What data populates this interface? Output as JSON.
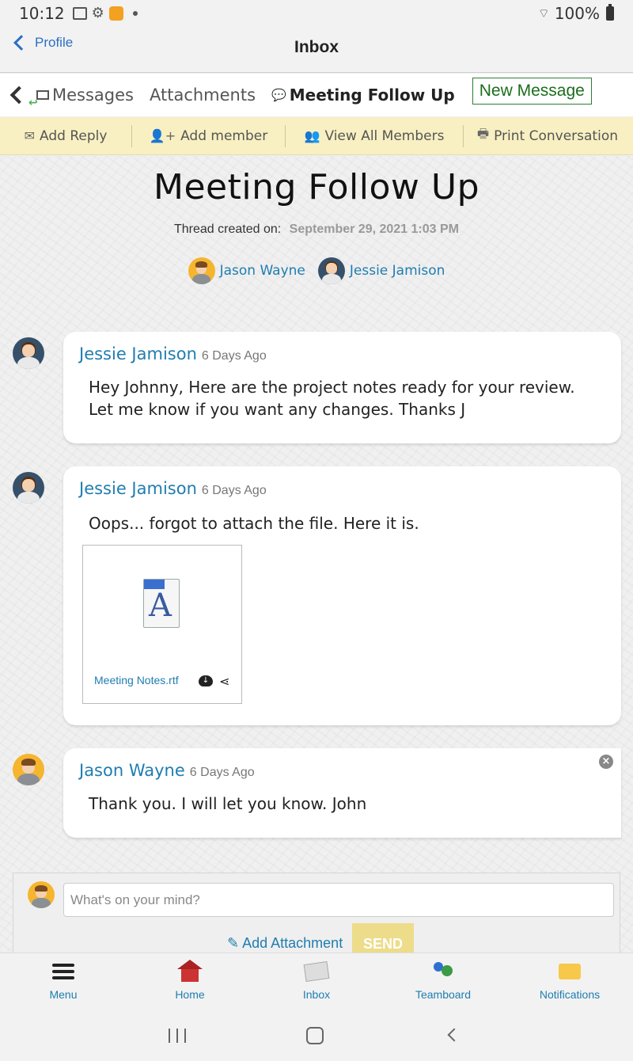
{
  "status": {
    "time": "10:12",
    "battery": "100%"
  },
  "header": {
    "back_label": "Profile",
    "title": "Inbox"
  },
  "tabs": {
    "messages": "Messages",
    "attachments": "Attachments",
    "active": "Meeting Follow Up",
    "new_message": "New Message"
  },
  "actions": {
    "add_reply": "Add Reply",
    "add_member": "Add member",
    "view_members": "View All Members",
    "print": "Print Conversation"
  },
  "thread": {
    "title": "Meeting Follow Up",
    "created_label": "Thread created on:",
    "created_value": "September 29, 2021 1:03 PM",
    "participants": [
      "Jason Wayne",
      "Jessie Jamison"
    ]
  },
  "messages": [
    {
      "author": "Jessie Jamison",
      "ago": "6 Days Ago",
      "text": "Hey Johnny, Here are the project notes ready for your review. Let me know if you want any changes. Thanks J"
    },
    {
      "author": "Jessie Jamison",
      "ago": "6 Days Ago",
      "text": "Oops... forgot to attach the file. Here it is.",
      "attachment": {
        "filename": "Meeting Notes.rtf",
        "icon_letter": "A"
      }
    },
    {
      "author": "Jason Wayne",
      "ago": "6 Days Ago",
      "text": "Thank you. I will let you know. John"
    }
  ],
  "compose": {
    "placeholder": "What's on your mind?",
    "add_attachment": "Add Attachment",
    "send": "SEND"
  },
  "bottom_nav": [
    "Menu",
    "Home",
    "Inbox",
    "Teamboard",
    "Notifications"
  ],
  "colors": {
    "accent": "#1f7db0",
    "action_bar": "#f8f0c2",
    "send_button": "#eddc8a",
    "new_message_border": "#2e7d32"
  }
}
